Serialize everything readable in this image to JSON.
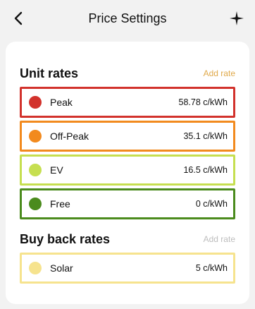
{
  "header": {
    "title": "Price Settings",
    "back_icon": "chevron-left-icon",
    "more_icon": "sparkle-icon"
  },
  "unit_rates": {
    "title": "Unit rates",
    "add_label": "Add rate",
    "add_color": "#e0a94a",
    "items": [
      {
        "name": "Peak",
        "value": "58.78 c/kWh",
        "color": "#d2322c"
      },
      {
        "name": "Off-Peak",
        "value": "35.1 c/kWh",
        "color": "#f28a1e"
      },
      {
        "name": "EV",
        "value": "16.5 c/kWh",
        "color": "#c6df50"
      },
      {
        "name": "Free",
        "value": "0 c/kWh",
        "color": "#4b8b1d"
      }
    ]
  },
  "buy_back_rates": {
    "title": "Buy back rates",
    "add_label": "Add rate",
    "add_color": "#bdbdbd",
    "items": [
      {
        "name": "Solar",
        "value": "5 c/kWh",
        "color": "#f6e38e"
      }
    ]
  }
}
